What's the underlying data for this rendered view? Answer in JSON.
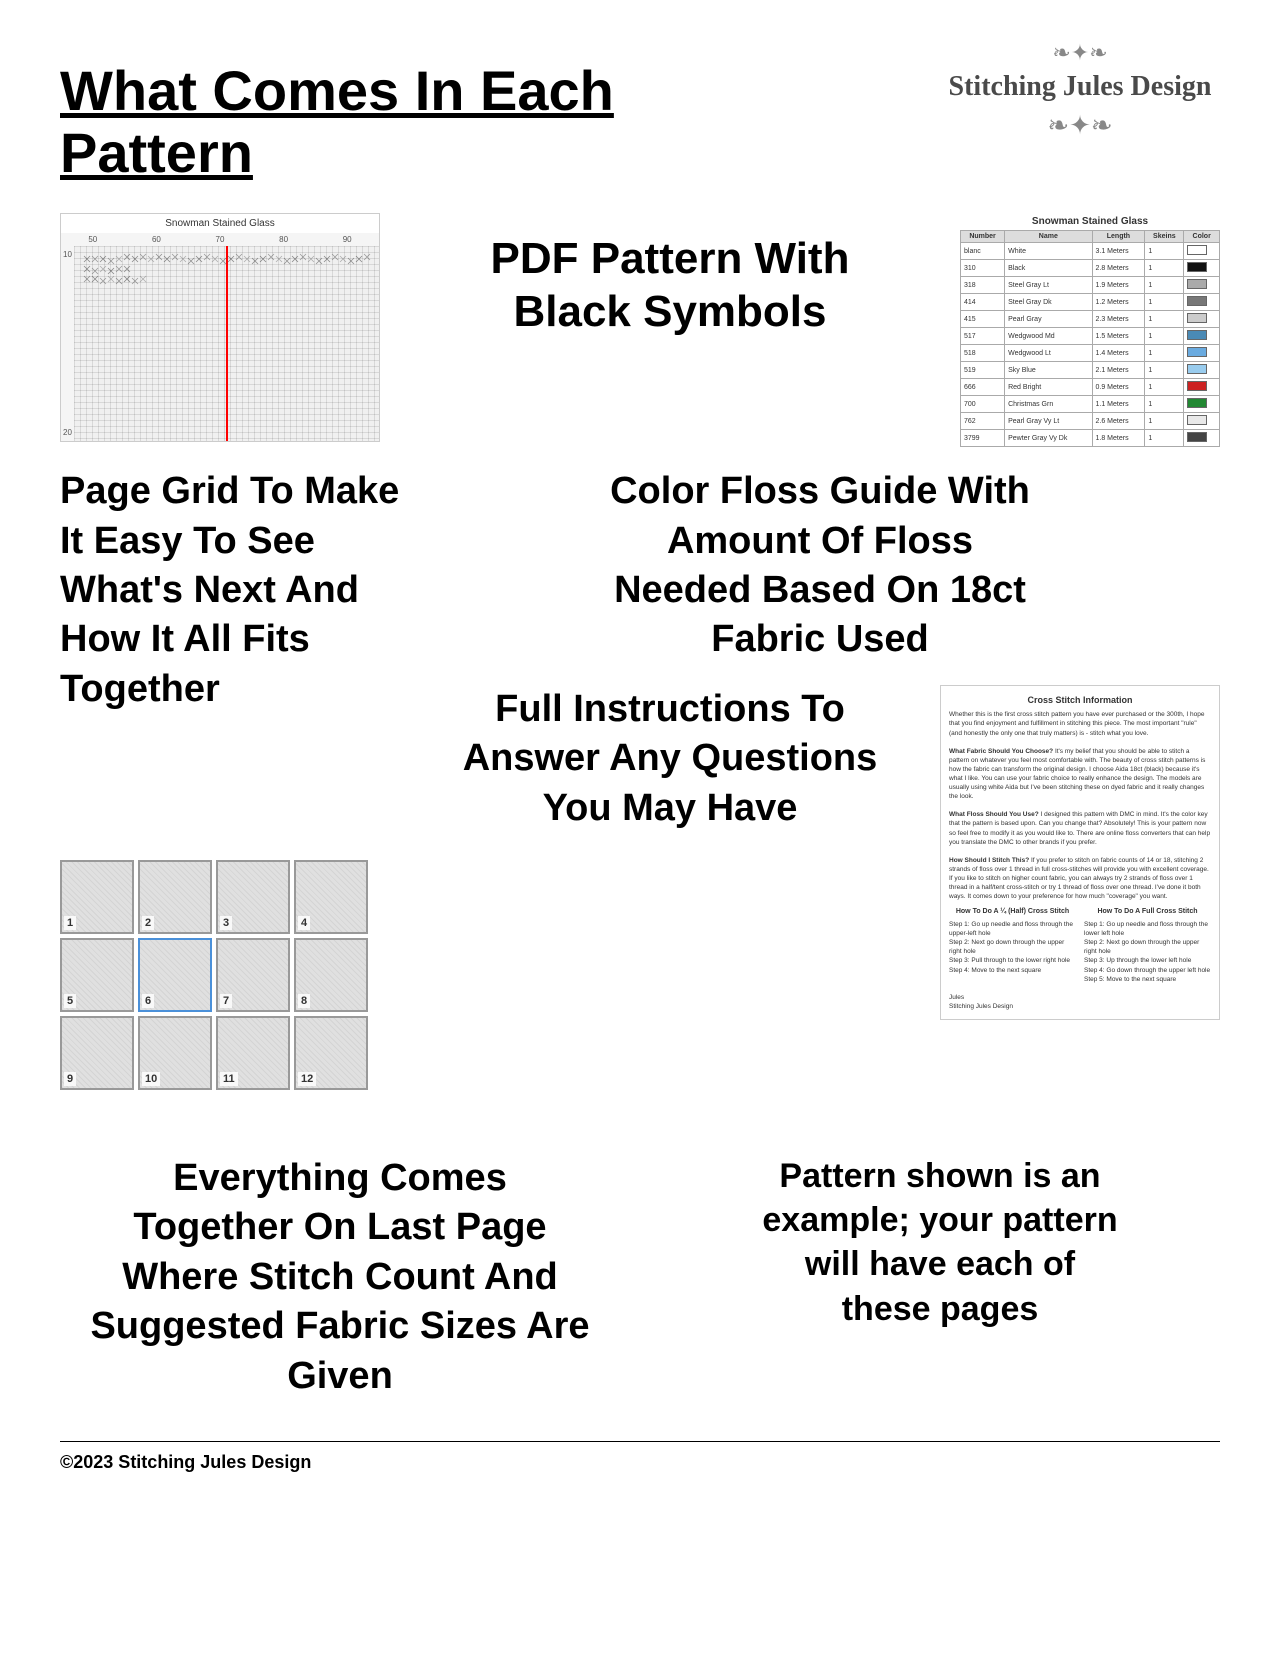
{
  "header": {
    "title": "What Comes In Each Pattern",
    "logo_name": "Stitching Jules Design",
    "logo_ornament": "❧ ✦ ❧"
  },
  "section1": {
    "pdf_text_line1": "PDF Pattern With",
    "pdf_text_line2": "Black Symbols",
    "pattern_title": "Snowman Stained Glass",
    "axis_labels": [
      "50",
      "60",
      "70",
      "80",
      "90"
    ],
    "row_labels": [
      "10",
      "20"
    ]
  },
  "section2": {
    "floss_table_title": "Snowman Stained Glass",
    "floss_headers": [
      "Number",
      "Name",
      "Length",
      "Skeins"
    ],
    "floss_rows": [
      {
        "num": "blanc",
        "name": "White",
        "length": "3.1 Meters",
        "skeins": "1"
      },
      {
        "num": "310",
        "name": "Black",
        "length": "2.8 Meters",
        "skeins": "1"
      },
      {
        "num": "318",
        "name": "Steel Gray Lt",
        "length": "1.9 Meters",
        "skeins": "1"
      },
      {
        "num": "414",
        "name": "Steel Gray Dk",
        "length": "1.2 Meters",
        "skeins": "1"
      },
      {
        "num": "415",
        "name": "Pearl Gray",
        "length": "2.3 Meters",
        "skeins": "1"
      },
      {
        "num": "517",
        "name": "Wedgwood Md",
        "length": "1.5 Meters",
        "skeins": "1"
      },
      {
        "num": "518",
        "name": "Wedgwood Lt",
        "length": "1.4 Meters",
        "skeins": "1"
      },
      {
        "num": "519",
        "name": "Sky Blue",
        "length": "2.1 Meters",
        "skeins": "1"
      },
      {
        "num": "666",
        "name": "Red Bright",
        "length": "0.9 Meters",
        "skeins": "1"
      },
      {
        "num": "700",
        "name": "Christmas Grn",
        "length": "1.1 Meters",
        "skeins": "1"
      },
      {
        "num": "762",
        "name": "Pearl Gray Vy Lt",
        "length": "2.6 Meters",
        "skeins": "1"
      },
      {
        "num": "3799",
        "name": "Pewter Gray Vy Dk",
        "length": "1.8 Meters",
        "skeins": "1"
      }
    ],
    "color_swatches": [
      "#fff",
      "#111",
      "#aaa",
      "#777",
      "#ccc",
      "#4a8ab5",
      "#6aabe0",
      "#99ccee",
      "#cc2222",
      "#228833",
      "#e8e8e8",
      "#444"
    ]
  },
  "section3": {
    "page_grid_text": "Page Grid To Make It Easy To See What's Next And How It All Fits Together",
    "color_floss_text_line1": "Color Floss Guide With",
    "color_floss_text_line2": "Amount Of Floss",
    "color_floss_text_line3": "Needed Based On 18ct",
    "color_floss_text_line4": "Fabric Used"
  },
  "section4": {
    "full_instructions_line1": "Full Instructions To",
    "full_instructions_line2": "Answer Any Questions",
    "full_instructions_line3": "You May Have",
    "instructions_doc_title": "Cross Stitch Information",
    "instructions_para1": "Whether this is the first cross stitch pattern you have ever purchased or the 300th, I hope that you find enjoyment and fulfillment in stitching this piece. The most important \"rule\" (and honestly the only one that truly matters) is - stitch what you love.",
    "instructions_para2_title": "What Fabric Should You Choose?",
    "instructions_para2": "It's my belief that you should be able to stitch a pattern on whatever you feel most comfortable with. The beauty of cross stitch patterns is how the fabric can transform the original design. I choose Aida 18ct (black) because it's what I like. You can use your fabric choice to really enhance the design. The models are usually using white Aida but I've been stitching these on dyed fabric and it really changes the look.",
    "instructions_para3_title": "What Floss Should You Use?",
    "instructions_para3": "I designed this pattern with DMC in mind. It's the color key that the pattern is based upon. Can you change that? Absolutely! This is your pattern now so feel free to modify it as you would like to. There are online floss converters that can help you translate the DMC to other brands if you prefer.",
    "instructions_para4_title": "How Should I Stitch This?",
    "instructions_para4": "If you prefer to stitch on fabric counts of 14 or 18, stitching 2 strands of floss over 1 thread in full cross-stitches will provide you with excellent coverage. If you like to stitch on higher count fabric, you can always try 2 strands of floss over 1 thread in a half/tent cross-stitch or try 1 thread of floss over one thread. I've done it both ways. It comes down to your preference for how much \"coverage\" you want.",
    "how_to_title": "How To Do A ¼ (Half) Cross Stitch",
    "how_to_full_title": "How To Do A Full Cross Stitch",
    "how_to_steps1": [
      "Step 1: Go up needle and floss through the upper-left hole",
      "Step 2: Next go down through the upper right hole",
      "Step 3: Pull through to the lower right hole",
      "Step 4: Move to the next square"
    ],
    "how_to_steps2": [
      "Step 1: Go up needle and floss through the lower left hole",
      "Step 2: Next go down through the upper right hole",
      "Step 3: Up through the lower left hole of the 5",
      "Step 4: Go down through the upper left hole",
      "Step 5: Move to the next square"
    ],
    "signature": "Jules\nStitching Jules Design",
    "thumbnails": [
      {
        "num": "1",
        "highlighted": false
      },
      {
        "num": "2",
        "highlighted": false
      },
      {
        "num": "3",
        "highlighted": false
      },
      {
        "num": "4",
        "highlighted": false
      },
      {
        "num": "5",
        "highlighted": false
      },
      {
        "num": "6",
        "highlighted": true
      },
      {
        "num": "7",
        "highlighted": false
      },
      {
        "num": "8",
        "highlighted": false
      },
      {
        "num": "9",
        "highlighted": false
      },
      {
        "num": "10",
        "highlighted": false
      },
      {
        "num": "11",
        "highlighted": false
      },
      {
        "num": "12",
        "highlighted": false
      }
    ]
  },
  "section5": {
    "everything_text_line1": "Everything Comes",
    "everything_text_line2": "Together On Last Page",
    "everything_text_line3": "Where Stitch Count And",
    "everything_text_line4": "Suggested Fabric Sizes Are",
    "everything_text_line5": "Given",
    "pattern_note_line1": "Pattern shown is an",
    "pattern_note_line2": "example; your pattern",
    "pattern_note_line3": "will have each of",
    "pattern_note_line4": "these pages"
  },
  "footer": {
    "copyright": "©2023 Stitching Jules Design"
  }
}
